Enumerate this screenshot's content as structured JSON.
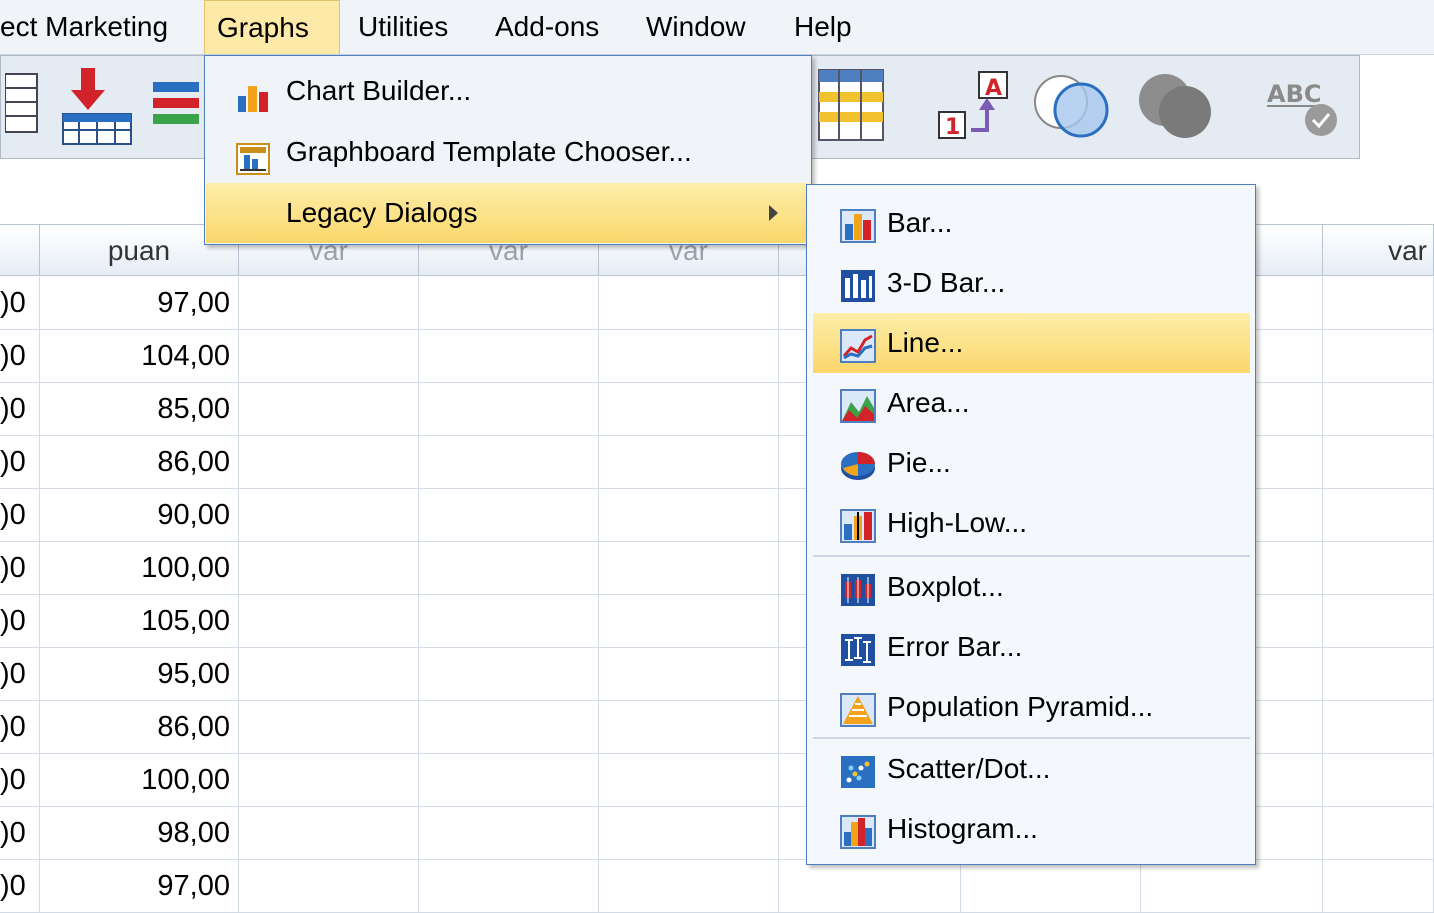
{
  "menubar": {
    "items": [
      {
        "label": "ect Marketing"
      },
      {
        "label": "Graphs"
      },
      {
        "label": "Utilities"
      },
      {
        "label": "Add-ons"
      },
      {
        "label": "Window"
      },
      {
        "label": "Help"
      }
    ],
    "active": "Graphs"
  },
  "toolbar": {
    "icons": [
      "go-to-case-icon",
      "insert-cases-icon",
      "insert-variable-icon",
      "value-labels-grid-icon",
      "value-labels-icon",
      "use-sets-icon",
      "show-all-variables-icon",
      "spell-check-icon"
    ]
  },
  "graphs_menu": {
    "items": [
      {
        "label": "Chart Builder...",
        "icon": "chart-builder-icon"
      },
      {
        "label": "Graphboard Template Chooser...",
        "icon": "graphboard-icon"
      },
      {
        "label": "Legacy Dialogs",
        "icon": "",
        "submenu": true
      }
    ]
  },
  "legacy_menu": {
    "items": [
      {
        "label": "Bar...",
        "icon": "bar-chart-icon"
      },
      {
        "label": "3-D Bar...",
        "icon": "3d-bar-chart-icon"
      },
      {
        "label": "Line...",
        "icon": "line-chart-icon",
        "highlighted": true
      },
      {
        "label": "Area...",
        "icon": "area-chart-icon"
      },
      {
        "label": "Pie...",
        "icon": "pie-chart-icon"
      },
      {
        "label": "High-Low...",
        "icon": "high-low-chart-icon"
      },
      {
        "label": "Boxplot...",
        "icon": "boxplot-icon"
      },
      {
        "label": "Error Bar...",
        "icon": "error-bar-icon"
      },
      {
        "label": "Population Pyramid...",
        "icon": "population-pyramid-icon"
      },
      {
        "label": "Scatter/Dot...",
        "icon": "scatter-dot-icon"
      },
      {
        "label": "Histogram...",
        "icon": "histogram-icon"
      }
    ]
  },
  "grid": {
    "headers": [
      "",
      "puan",
      "var",
      "var",
      "var",
      "",
      "",
      "",
      "var"
    ],
    "partial_col": ")0",
    "puan_values": [
      "97,00",
      "104,00",
      "85,00",
      "86,00",
      "90,00",
      "100,00",
      "105,00",
      "95,00",
      "86,00",
      "100,00",
      "98,00",
      "97,00"
    ]
  },
  "colors": {
    "menu_highlight": "#fbd76d",
    "menu_border": "#4f7fc1",
    "menubar_bg": "#f0f4f8",
    "header_bg": "#e6edf5"
  }
}
